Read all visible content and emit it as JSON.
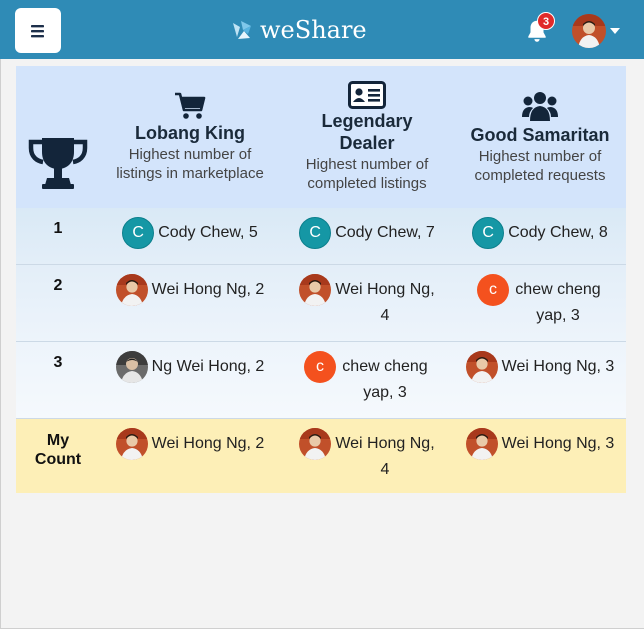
{
  "navbar": {
    "brand": "weShare",
    "notification_count": "3",
    "colors": {
      "bar": "#2f8bb6",
      "badge": "#e02a2a"
    },
    "icons": [
      "menu-icon",
      "weshare-logo-icon",
      "bell-icon",
      "avatar",
      "caret-down-icon"
    ]
  },
  "leaderboard": {
    "categories": [
      {
        "title": "Lobang King",
        "description": "Highest number of listings in marketplace",
        "icon": "shopping-cart-icon"
      },
      {
        "title": "Legendary Dealer",
        "description": "Highest number of completed listings",
        "icon": "id-card-icon"
      },
      {
        "title": "Good Samaritan",
        "description": "Highest number of completed requests",
        "icon": "users-icon"
      }
    ],
    "rows": [
      {
        "rank": "1",
        "entries": [
          {
            "text": "Cody Chew, 5",
            "avatar": "C",
            "avatar_type": "letter-teal"
          },
          {
            "text": "Cody Chew, 7",
            "avatar": "C",
            "avatar_type": "letter-teal"
          },
          {
            "text": "Cody Chew, 8",
            "avatar": "C",
            "avatar_type": "letter-teal"
          }
        ]
      },
      {
        "rank": "2",
        "entries": [
          {
            "text": "Wei Hong Ng, 2",
            "avatar": "",
            "avatar_type": "photo-red"
          },
          {
            "text": "Wei Hong Ng, 4",
            "avatar": "",
            "avatar_type": "photo-red"
          },
          {
            "text": "chew cheng yap, 3",
            "avatar": "c",
            "avatar_type": "letter-orange"
          }
        ]
      },
      {
        "rank": "3",
        "entries": [
          {
            "text": "Ng Wei Hong, 2",
            "avatar": "",
            "avatar_type": "photo-dark"
          },
          {
            "text": "chew cheng yap, 3",
            "avatar": "c",
            "avatar_type": "letter-orange"
          },
          {
            "text": "Wei Hong Ng, 3",
            "avatar": "",
            "avatar_type": "photo-red"
          }
        ]
      },
      {
        "rank": "My Count",
        "entries": [
          {
            "text": "Wei Hong Ng, 2",
            "avatar": "",
            "avatar_type": "photo-red"
          },
          {
            "text": "Wei Hong Ng, 4",
            "avatar": "",
            "avatar_type": "photo-red"
          },
          {
            "text": "Wei Hong Ng, 3",
            "avatar": "",
            "avatar_type": "photo-red"
          }
        ]
      }
    ],
    "colors": {
      "header_bg": "#d3e4fb",
      "rank_rows_gradient": [
        "#dcebf7",
        "#f3f8fd"
      ],
      "my_count_bg": "#fdefb7",
      "teal_avatar": "#1597a5",
      "orange_avatar": "#f4511e"
    }
  }
}
